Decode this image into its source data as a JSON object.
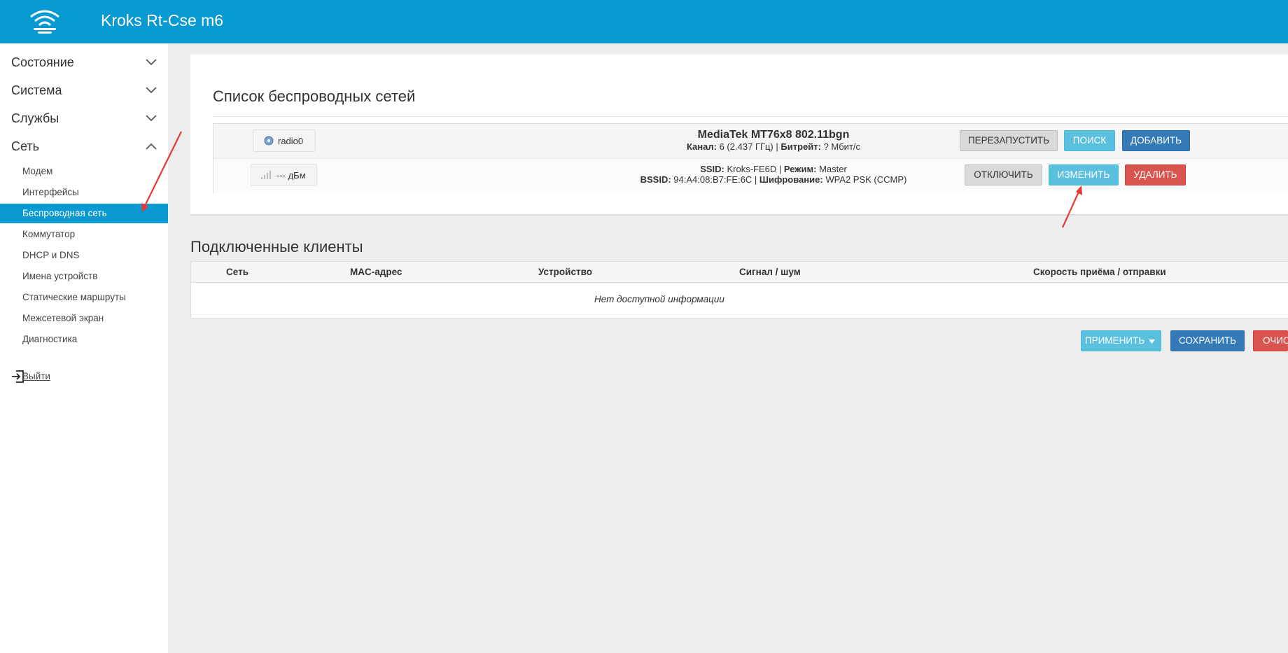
{
  "header": {
    "title": "Kroks Rt-Cse m6"
  },
  "sidebar": {
    "sections": [
      {
        "label": "Состояние",
        "expanded": false
      },
      {
        "label": "Система",
        "expanded": false
      },
      {
        "label": "Службы",
        "expanded": false
      },
      {
        "label": "Сеть",
        "expanded": true
      }
    ],
    "network_items": [
      {
        "label": "Модем"
      },
      {
        "label": "Интерфейсы"
      },
      {
        "label": "Беспроводная сеть",
        "active": true
      },
      {
        "label": "Коммутатор"
      },
      {
        "label": "DHCP и DNS"
      },
      {
        "label": "Имена устройств"
      },
      {
        "label": "Статические маршруты"
      },
      {
        "label": "Межсетевой экран"
      },
      {
        "label": "Диагностика"
      }
    ],
    "logout_label": "Выйти"
  },
  "wireless": {
    "title": "Список беспроводных сетей",
    "radio": {
      "device_label": "radio0",
      "name": "MediaTek MT76x8 802.11bgn",
      "channel_label": "Канал:",
      "channel_value": "6 (2.437 ГГц)",
      "bitrate_label": "Битрейт:",
      "bitrate_value": "? Мбит/с",
      "buttons": {
        "restart": "ПЕРЕЗАПУСТИТЬ",
        "scan": "ПОИСК",
        "add": "ДОБАВИТЬ"
      }
    },
    "network": {
      "signal_label": "--- дБм",
      "ssid_label": "SSID:",
      "ssid_value": "Kroks-FE6D",
      "mode_label": "Режим:",
      "mode_value": "Master",
      "bssid_label": "BSSID:",
      "bssid_value": "94:A4:08:B7:FE:6C",
      "encryption_label": "Шифрование:",
      "encryption_value": "WPA2 PSK (CCMP)",
      "buttons": {
        "disable": "ОТКЛЮЧИТЬ",
        "edit": "ИЗМЕНИТЬ",
        "delete": "УДАЛИТЬ"
      }
    }
  },
  "clients": {
    "title": "Подключенные клиенты",
    "columns": [
      "Сеть",
      "MAC-адрес",
      "Устройство",
      "Сигнал / шум",
      "Скорость приёма / отправки"
    ],
    "empty_text": "Нет доступной информации"
  },
  "actions": {
    "apply": "ПРИМЕНИТЬ",
    "save": "СОХРАНИТЬ",
    "reset": "ОЧИСТИТЬ"
  },
  "colors": {
    "header": "#0699d2",
    "active": "#0a99d0",
    "annotation_arrow": "#e53935"
  }
}
